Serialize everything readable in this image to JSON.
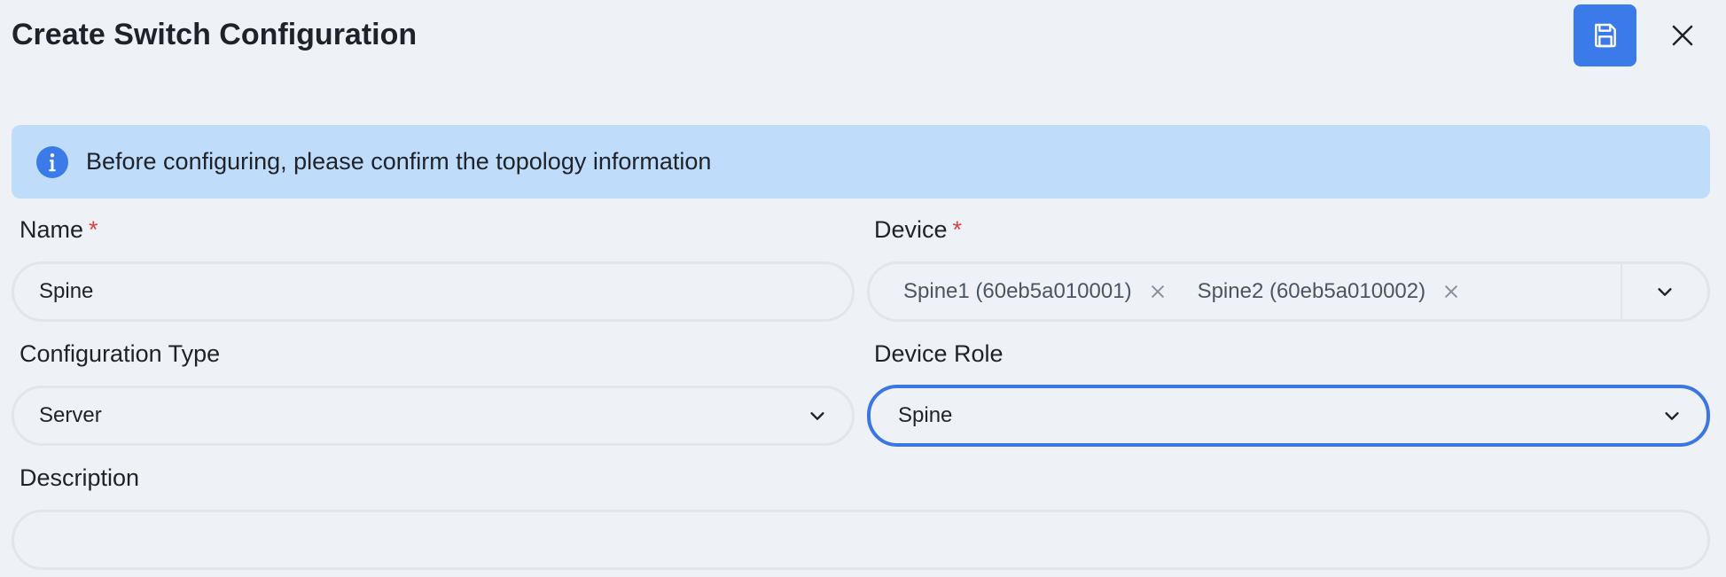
{
  "header": {
    "title": "Create Switch Configuration"
  },
  "banner": {
    "message": "Before configuring, please confirm the topology information"
  },
  "form": {
    "name": {
      "label": "Name",
      "required_mark": "*",
      "value": "Spine"
    },
    "device": {
      "label": "Device",
      "required_mark": "*",
      "selected": [
        "Spine1 (60eb5a010001)",
        "Spine2 (60eb5a010002)"
      ]
    },
    "configuration_type": {
      "label": "Configuration Type",
      "value": "Server"
    },
    "device_role": {
      "label": "Device Role",
      "value": "Spine"
    },
    "description": {
      "label": "Description",
      "value": ""
    }
  },
  "colors": {
    "accent": "#3b7be9",
    "banner_bg": "#bfdcfb",
    "required": "#d64545",
    "page_bg": "#eef1f6",
    "focus_border": "#3b76e3"
  },
  "icons": {
    "save": "floppy-disk-icon",
    "close": "close-icon",
    "info": "info-icon",
    "chevron": "chevron-down-icon",
    "chip_remove": "x-icon"
  }
}
